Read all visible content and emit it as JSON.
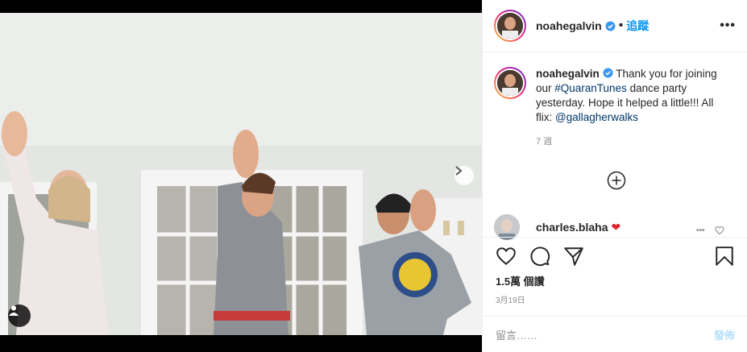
{
  "post": {
    "username": "noahegalvin",
    "follow_label": "追蹤",
    "more_label": "•••"
  },
  "caption": {
    "username": "noahegalvin",
    "text_before": " Thank you for joining our ",
    "hashtag": "#QuaranTunes",
    "text_middle": " dance party yesterday. Hope it helped a little!!! All flix: ",
    "mention": "@gallagherwalks",
    "age": "7 週"
  },
  "comment": {
    "username": "charles.blaha",
    "emoji": "❤"
  },
  "stats": {
    "likes": "1.5萬 個讚",
    "date": "3月19日"
  },
  "comment_box": {
    "placeholder": "留言……",
    "post_label": "發佈"
  },
  "icons": {
    "verified": "verified-badge-icon",
    "like": "heart-icon",
    "comment": "comment-icon",
    "share": "paper-plane-icon",
    "save": "bookmark-icon",
    "load_more": "plus-circle-icon",
    "next": "chevron-right-icon",
    "tag": "user-tag-icon"
  },
  "colors": {
    "accent": "#0095f6",
    "link": "#00376b",
    "muted": "#8e8e8e",
    "post_disabled": "#b2dffc"
  }
}
